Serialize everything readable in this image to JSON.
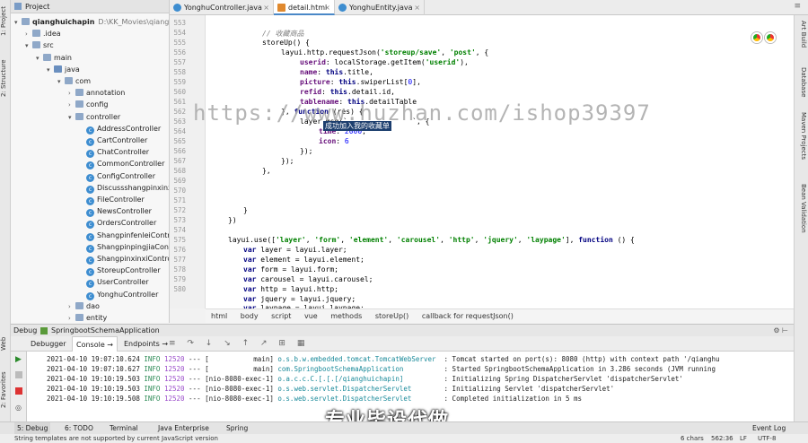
{
  "left_strip": {
    "project_label": "1: Project",
    "structure_label": "2: Structure",
    "web_label": "Web",
    "favorites_label": "2: Favorites"
  },
  "project": {
    "header": "Project",
    "tree": [
      {
        "label": "qianghuichapin",
        "suffix": "D:\\KK_Movies\\qianghuic",
        "depth": 0,
        "arrow": "▾",
        "kind": "folder"
      },
      {
        "label": ".idea",
        "depth": 1,
        "arrow": "›",
        "kind": "folder"
      },
      {
        "label": "src",
        "depth": 1,
        "arrow": "▾",
        "kind": "folder"
      },
      {
        "label": "main",
        "depth": 2,
        "arrow": "▾",
        "kind": "folder"
      },
      {
        "label": "java",
        "depth": 3,
        "arrow": "▾",
        "kind": "src"
      },
      {
        "label": "com",
        "depth": 4,
        "arrow": "▾",
        "kind": "folder"
      },
      {
        "label": "annotation",
        "depth": 5,
        "arrow": "›",
        "kind": "folder"
      },
      {
        "label": "config",
        "depth": 5,
        "arrow": "›",
        "kind": "folder"
      },
      {
        "label": "controller",
        "depth": 5,
        "arrow": "▾",
        "kind": "folder"
      },
      {
        "label": "AddressController",
        "depth": 6,
        "arrow": "",
        "kind": "class"
      },
      {
        "label": "CartController",
        "depth": 6,
        "arrow": "",
        "kind": "class"
      },
      {
        "label": "ChatController",
        "depth": 6,
        "arrow": "",
        "kind": "class"
      },
      {
        "label": "CommonController",
        "depth": 6,
        "arrow": "",
        "kind": "class"
      },
      {
        "label": "ConfigController",
        "depth": 6,
        "arrow": "",
        "kind": "class"
      },
      {
        "label": "Discussshangpinxinxi",
        "depth": 6,
        "arrow": "",
        "kind": "class"
      },
      {
        "label": "FileController",
        "depth": 6,
        "arrow": "",
        "kind": "class"
      },
      {
        "label": "NewsController",
        "depth": 6,
        "arrow": "",
        "kind": "class"
      },
      {
        "label": "OrdersController",
        "depth": 6,
        "arrow": "",
        "kind": "class"
      },
      {
        "label": "ShangpinfenleiContro",
        "depth": 6,
        "arrow": "",
        "kind": "class"
      },
      {
        "label": "ShangpinpingjiaContr",
        "depth": 6,
        "arrow": "",
        "kind": "class"
      },
      {
        "label": "ShangpinxinxiControl",
        "depth": 6,
        "arrow": "",
        "kind": "class"
      },
      {
        "label": "StoreupController",
        "depth": 6,
        "arrow": "",
        "kind": "class"
      },
      {
        "label": "UserController",
        "depth": 6,
        "arrow": "",
        "kind": "class"
      },
      {
        "label": "YonghuController",
        "depth": 6,
        "arrow": "",
        "kind": "class"
      },
      {
        "label": "dao",
        "depth": 5,
        "arrow": "›",
        "kind": "folder"
      },
      {
        "label": "entity",
        "depth": 5,
        "arrow": "›",
        "kind": "folder"
      }
    ]
  },
  "tabs": [
    {
      "label": "YonghuController.java",
      "active": false
    },
    {
      "label": "detail.html",
      "active": true
    },
    {
      "label": "YonghuEntity.java",
      "active": false
    }
  ],
  "code": {
    "line_numbers": [
      "553",
      "554",
      "555",
      "556",
      "557",
      "558",
      "559",
      "560",
      "561",
      "562",
      "563",
      "564",
      "565",
      "566",
      "567",
      "568",
      "569",
      "570",
      "571",
      "572",
      "573",
      "574",
      "575",
      "576",
      "577",
      "578",
      "579",
      "580"
    ],
    "watermark": "https://www.huzhan.com/ishop39397",
    "tooltip": "成功加入我的收藏单"
  },
  "breadcrumb": [
    "html",
    "body",
    "script",
    "vue",
    "methods",
    "storeUp()",
    "callback for requestJson()"
  ],
  "right_strip": [
    "Art Build",
    "Database",
    "Maven Projects",
    "Bean Validation"
  ],
  "debug": {
    "title": "Debug",
    "config": "SpringbootSchemaApplication",
    "tabs": [
      "Debugger",
      "Console →",
      "Endpoints →"
    ],
    "logs": [
      {
        "date": "2021-04-10 19:07:10.624",
        "level": "INFO",
        "pid": "12520",
        "sep": "---",
        "thread": "[           main]",
        "cls": "o.s.b.w.embedded.tomcat.TomcatWebServer ",
        "msg": ": Tomcat started on port(s): 8080 (http) with context path '/qianghu"
      },
      {
        "date": "2021-04-10 19:07:10.627",
        "level": "INFO",
        "pid": "12520",
        "sep": "---",
        "thread": "[           main]",
        "cls": "com.SpringbootSchemaApplication         ",
        "msg": ": Started SpringbootSchemaApplication in 3.286 seconds (JVM running"
      },
      {
        "date": "2021-04-10 19:10:19.503",
        "level": "INFO",
        "pid": "12520",
        "sep": "---",
        "thread": "[nio-8080-exec-1]",
        "cls": "o.a.c.c.C.[.[.[/qianghuichapin]         ",
        "msg": ": Initializing Spring DispatcherServlet 'dispatcherServlet'"
      },
      {
        "date": "2021-04-10 19:10:19.503",
        "level": "INFO",
        "pid": "12520",
        "sep": "---",
        "thread": "[nio-8080-exec-1]",
        "cls": "o.s.web.servlet.DispatcherServlet       ",
        "msg": ": Initializing Servlet 'dispatcherServlet'"
      },
      {
        "date": "2021-04-10 19:10:19.508",
        "level": "INFO",
        "pid": "12520",
        "sep": "---",
        "thread": "[nio-8080-exec-1]",
        "cls": "o.s.web.servlet.DispatcherServlet       ",
        "msg": ": Completed initialization in 5 ms"
      }
    ],
    "overlay_text": "专业毕设代做"
  },
  "bottom_tools": [
    "5: Debug",
    "6: TODO",
    "Terminal",
    "Java Enterprise",
    "Spring",
    "Event Log"
  ],
  "status": {
    "message": "String templates are not supported by current JavaScript version",
    "chars": "6 chars",
    "position": "562:36",
    "line_sep": "LF",
    "encoding": "UTF-8"
  }
}
